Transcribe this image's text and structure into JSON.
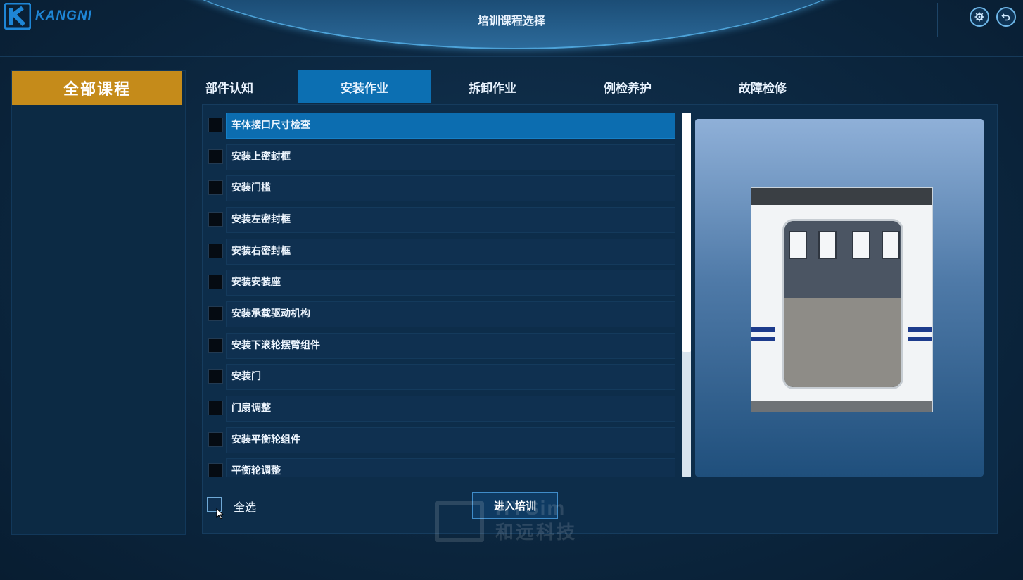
{
  "header": {
    "logo_text": "KANGNI",
    "title": "培训课程选择",
    "settings_icon": "gear-icon",
    "back_icon": "return-arrow-icon"
  },
  "sidebar": {
    "all_courses_label": "全部课程",
    "accent_color": "#c58b1a"
  },
  "tabs": [
    {
      "label": "部件认知",
      "active": false
    },
    {
      "label": "安装作业",
      "active": true
    },
    {
      "label": "拆卸作业",
      "active": false
    },
    {
      "label": "例检养护",
      "active": false
    },
    {
      "label": "故障检修",
      "active": false
    }
  ],
  "courses": [
    {
      "label": "车体接口尺寸检查",
      "checked": false,
      "selected": true
    },
    {
      "label": "安装上密封框",
      "checked": false,
      "selected": false
    },
    {
      "label": "安装门槛",
      "checked": false,
      "selected": false
    },
    {
      "label": "安装左密封框",
      "checked": false,
      "selected": false
    },
    {
      "label": "安装右密封框",
      "checked": false,
      "selected": false
    },
    {
      "label": "安装安装座",
      "checked": false,
      "selected": false
    },
    {
      "label": "安装承载驱动机构",
      "checked": false,
      "selected": false
    },
    {
      "label": "安装下滚轮摆臂组件",
      "checked": false,
      "selected": false
    },
    {
      "label": "安装门",
      "checked": false,
      "selected": false
    },
    {
      "label": "门扇调整",
      "checked": false,
      "selected": false
    },
    {
      "label": "安装平衡轮组件",
      "checked": false,
      "selected": false
    },
    {
      "label": "平衡轮调整",
      "checked": false,
      "selected": false
    }
  ],
  "footer": {
    "select_all_label": "全选",
    "enter_button_label": "进入培训"
  },
  "watermark": {
    "brand_en": "HYSim",
    "brand_cn": "和远科技"
  },
  "colors": {
    "active_tab": "#0c6fb2",
    "selected_row": "#0c6db0"
  }
}
